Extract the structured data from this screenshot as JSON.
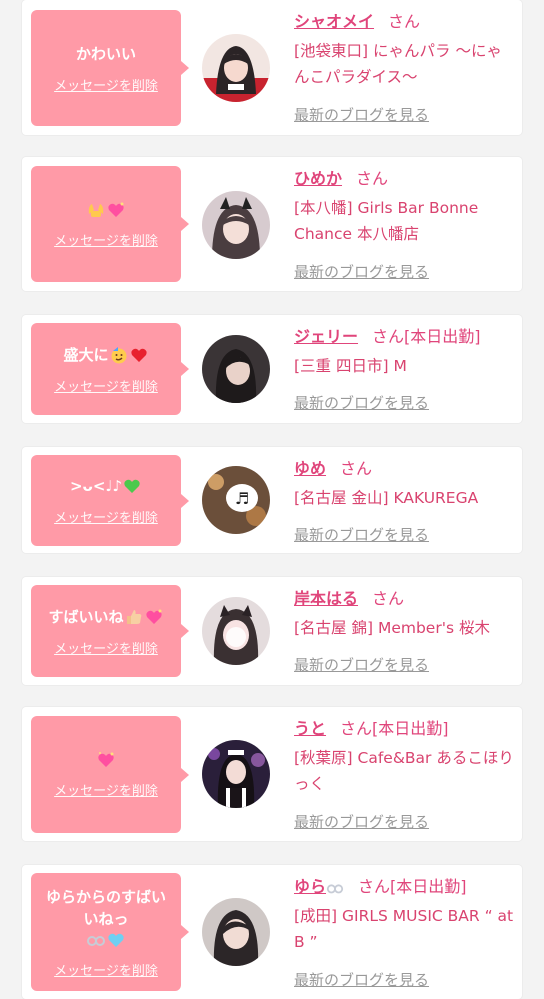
{
  "delete_label": "メッセージを削除",
  "blog_label": "最新のブログを見る",
  "san_label": "さん",
  "cards": [
    {
      "message": "かわいい",
      "name": "シャオメイ",
      "status": "",
      "shop": "[池袋東口] にゃんパラ 〜にゃんこパラダイス〜"
    },
    {
      "message": "",
      "name": "ひめか",
      "status": "",
      "shop": "[本八幡] Girls Bar Bonne Chance 本八幡店"
    },
    {
      "message": "盛大に",
      "name": "ジェリー",
      "status": "[本日出勤]",
      "shop": "[三重 四日市] M"
    },
    {
      "message": ">ᴗ<♩♪",
      "name": "ゆめ",
      "status": "",
      "shop": "[名古屋 金山] KAKUREGA"
    },
    {
      "message": "すばいいね",
      "name": "岸本はる",
      "status": "",
      "shop": "[名古屋 錦] Member's 桜木"
    },
    {
      "message": "",
      "name": "うと",
      "status": "[本日出勤]",
      "shop": "[秋葉原] Cafe&Bar あるこほりっく"
    },
    {
      "message": "ゆらからのすばいいねっ",
      "name": "ゆら",
      "status": "[本日出勤]",
      "shop": "[成田] GIRLS MUSIC BAR “ at B ”"
    }
  ]
}
